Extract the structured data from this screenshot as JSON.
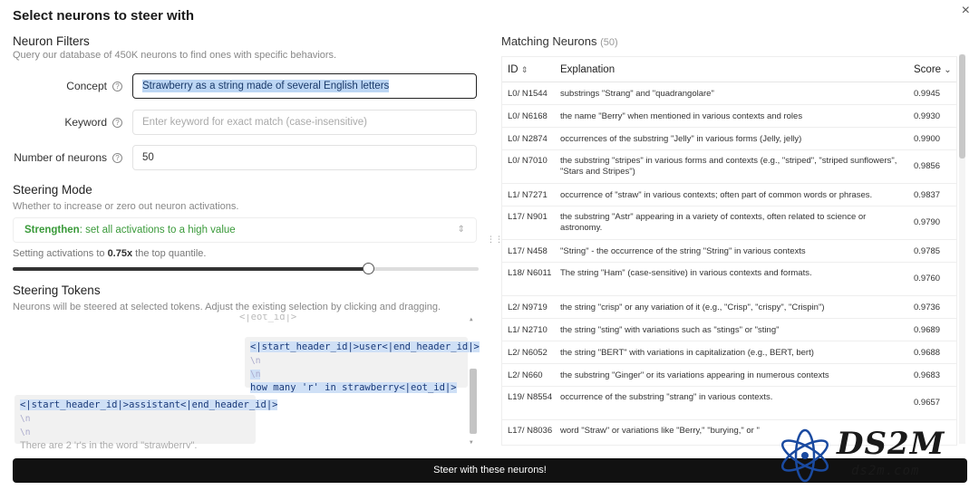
{
  "dialog": {
    "title": "Select neurons to steer with",
    "close_icon": "×"
  },
  "filters": {
    "title": "Neuron Filters",
    "subtitle": "Query our database of 450K neurons to find ones with specific behaviors.",
    "concept_label": "Concept",
    "concept_value": "Strawberry as a string made of several English letters",
    "keyword_label": "Keyword",
    "keyword_placeholder": "Enter keyword for exact match (case-insensitive)",
    "num_label": "Number of neurons",
    "num_value": "50",
    "help_icon": "?"
  },
  "mode": {
    "title": "Steering Mode",
    "subtitle": "Whether to increase or zero out neuron activations.",
    "selected_bold": "Strengthen",
    "selected_rest": ": set all activations to a high value",
    "chevron": "⇕",
    "act_prefix": "Setting activations to ",
    "act_value": "0.75x",
    "act_suffix": " the top quantile.",
    "slider_fraction": 0.75
  },
  "tokens": {
    "title": "Steering Tokens",
    "subtitle": "Neurons will be steered at selected tokens. Adjust the existing selection by clicking and dragging.",
    "top_fragment": "<|eot_id|>",
    "user_header": "<|start_header_id|>user<|end_header_id|>",
    "user_nl1": "\\n",
    "user_nl2": "\\n",
    "user_text": "how many 'r' in strawberry<|eot_id|>",
    "asst_header": "<|start_header_id|>assistant<|end_header_id|>",
    "asst_nl1": "\\n",
    "asst_nl2": "\\n",
    "asst_text": "There are 2 'r's in the word \"strawberry\"."
  },
  "steer_button": "Steer with these neurons!",
  "results": {
    "title": "Matching Neurons",
    "count": "(50)",
    "col_id": "ID",
    "col_id_icon": "⇕",
    "col_expl": "Explanation",
    "col_score": "Score",
    "col_score_icon": "⌄",
    "rows": [
      {
        "id": "L0/ N1544",
        "expl": "substrings \"Strang\" and \"quadrangolare\"",
        "score": "0.9945"
      },
      {
        "id": "L0/ N6168",
        "expl": "the name \"Berry\" when mentioned in various contexts and roles",
        "score": "0.9930"
      },
      {
        "id": "L0/ N2874",
        "expl": "occurrences of the substring \"Jelly\" in various forms (Jelly, jelly)",
        "score": "0.9900"
      },
      {
        "id": "L0/ N7010",
        "expl": "the substring \"stripes\" in various forms and contexts (e.g., \"striped\", \"striped sunflowers\", \"Stars and Stripes\")",
        "score": "0.9856"
      },
      {
        "id": "L1/ N7271",
        "expl": "occurrence of \"straw\" in various contexts; often part of common words or phrases.",
        "score": "0.9837"
      },
      {
        "id": "L17/ N901",
        "expl": "the substring \"Astr\" appearing in a variety of contexts, often related to science or astronomy.",
        "score": "0.9790"
      },
      {
        "id": "L17/ N458",
        "expl": "\"String\" - the occurrence of the string \"String\" in various contexts",
        "score": "0.9785"
      },
      {
        "id": "L18/ N6011",
        "expl": "The string \"Ham\" (case-sensitive) in various contexts and formats.",
        "score": "0.9760"
      },
      {
        "id": "L2/ N9719",
        "expl": "the string \"crisp\" or any variation of it (e.g., \"Crisp\", \"crispy\", \"Crispin\")",
        "score": "0.9736"
      },
      {
        "id": "L1/ N2710",
        "expl": "the string \"sting\" with variations such as \"stings\" or \"sting\"",
        "score": "0.9689"
      },
      {
        "id": "L2/ N6052",
        "expl": "the string \"BERT\" with variations in capitalization (e.g., BERT, bert)",
        "score": "0.9688"
      },
      {
        "id": "L2/ N660",
        "expl": "the substring \"Ginger\" or its variations appearing in numerous contexts",
        "score": "0.9683"
      },
      {
        "id": "L19/ N8554",
        "expl": "occurrence of the substring \"strang\" in various contexts.",
        "score": "0.9657"
      },
      {
        "id": "L17/ N8036",
        "expl": "word \"Straw\" or variations like \"Berry,\" \"burying,\" or \"",
        "score": ""
      }
    ]
  },
  "watermark": {
    "logo": "DS2M",
    "url": "ds2m.com"
  }
}
